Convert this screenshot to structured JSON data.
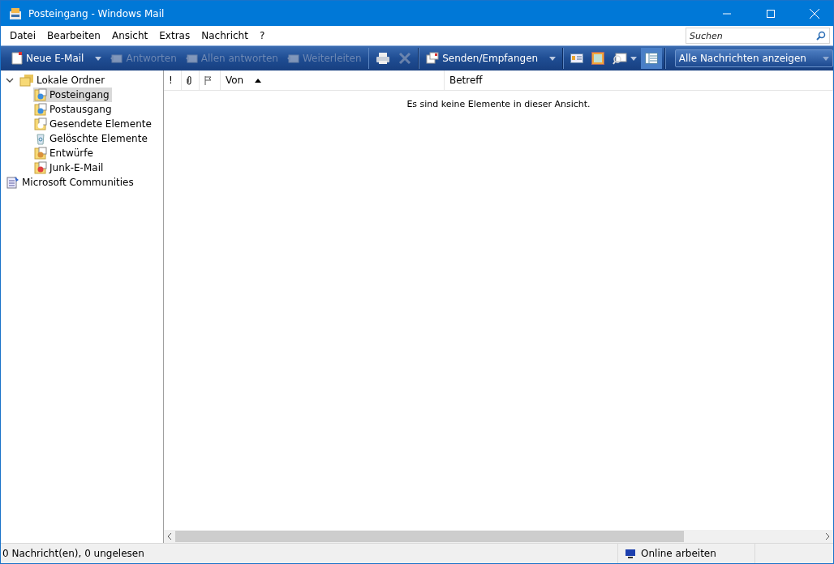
{
  "window": {
    "title": "Posteingang - Windows Mail"
  },
  "menu": [
    "Datei",
    "Bearbeiten",
    "Ansicht",
    "Extras",
    "Nachricht",
    "?"
  ],
  "search": {
    "placeholder": "Suchen"
  },
  "toolbar": [
    {
      "kind": "text",
      "label": "Neue E-Mail",
      "disabled": false,
      "dropdown": true
    },
    {
      "kind": "text",
      "label": "Antworten",
      "disabled": true,
      "dropdown": false
    },
    {
      "kind": "text",
      "label": "Allen antworten",
      "disabled": true,
      "dropdown": false
    },
    {
      "kind": "text",
      "label": "Weiterleiten",
      "disabled": true,
      "dropdown": false
    },
    {
      "kind": "separator"
    },
    {
      "kind": "icon",
      "disabled": false,
      "dropdown": false,
      "selected": false
    },
    {
      "kind": "icon",
      "disabled": true,
      "dropdown": false,
      "selected": false
    },
    {
      "kind": "separator"
    },
    {
      "kind": "text",
      "label": "Senden/Empfangen",
      "disabled": false,
      "dropdown": true
    },
    {
      "kind": "separator"
    },
    {
      "kind": "icon",
      "disabled": false,
      "dropdown": false,
      "selected": false
    },
    {
      "kind": "icon",
      "disabled": false,
      "dropdown": false,
      "selected": false
    },
    {
      "kind": "icon",
      "disabled": false,
      "dropdown": true,
      "selected": false
    },
    {
      "kind": "icon",
      "disabled": false,
      "dropdown": false,
      "selected": true
    }
  ],
  "view_filter": {
    "value": "Alle Nachrichten anzeigen"
  },
  "folders": [
    {
      "label": "Lokale Ordner",
      "selected": false,
      "expanded": true,
      "children": [
        {
          "label": "Posteingang",
          "selected": true
        },
        {
          "label": "Postausgang",
          "selected": false
        },
        {
          "label": "Gesendete Elemente",
          "selected": false
        },
        {
          "label": "Gelöschte Elemente",
          "selected": false
        },
        {
          "label": "Entwürfe",
          "selected": false
        },
        {
          "label": "Junk-E-Mail",
          "selected": false
        }
      ]
    },
    {
      "label": "Microsoft Communities",
      "selected": false
    }
  ],
  "columns": [
    {
      "kind": "text",
      "label": "!",
      "sorted": false
    },
    {
      "kind": "attachment",
      "sorted": false
    },
    {
      "kind": "flag",
      "sorted": false
    },
    {
      "kind": "text",
      "label": "Von",
      "sorted": true
    },
    {
      "kind": "text",
      "label": "Betreff",
      "sorted": false
    }
  ],
  "empty_message": "Es sind keine Elemente in dieser Ansicht.",
  "status_bar": {
    "message": "0 Nachricht(en), 0 ungelesen",
    "connection": "Online arbeiten"
  }
}
